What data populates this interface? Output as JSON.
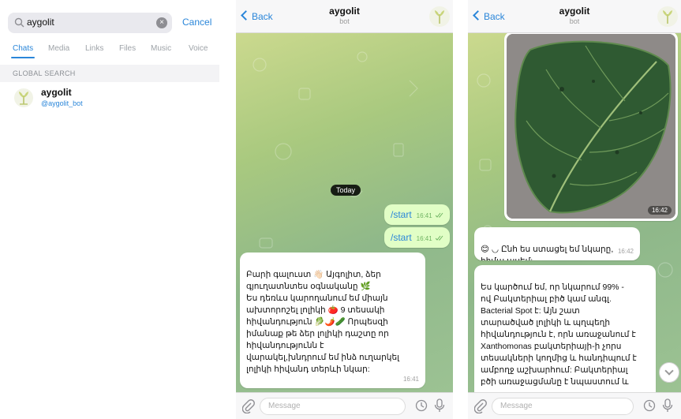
{
  "search_panel": {
    "query": "aygolit",
    "cancel_label": "Cancel",
    "tabs": [
      {
        "label": "Chats",
        "active": true
      },
      {
        "label": "Media",
        "active": false
      },
      {
        "label": "Links",
        "active": false
      },
      {
        "label": "Files",
        "active": false
      },
      {
        "label": "Music",
        "active": false
      },
      {
        "label": "Voice",
        "active": false
      }
    ],
    "section_header": "GLOBAL SEARCH",
    "result": {
      "name": "aygolit",
      "handle": "@aygolit_bot"
    }
  },
  "chat1": {
    "back_label": "Back",
    "title": "aygolit",
    "subtitle": "bot",
    "date_label": "Today",
    "outgoing": [
      {
        "text": "/start",
        "time": "16:41"
      },
      {
        "text": "/start",
        "time": "16:41"
      }
    ],
    "incoming": {
      "text": "Բարի գալուստ 👋🏻 Այգոլիտ, ձեր\nգյուղատնտես օգնականը 🌿\nԵս դեռևս կարողանում եմ միայն\nախտորոշել լոլիկի 🍅 9 տեսակի\nհիվանդություն 🥬🌶️🥒 Որպեսզի\nիմանաք թե ձեր լոլիկի դաշտը որ\nհիվանդությունն է\nվարակել,խնդրում եմ ինձ ուղարկել\nլոլիկի հիվանդ տերևի նկար:",
      "time": "16:41"
    },
    "composer_placeholder": "Message"
  },
  "chat2": {
    "back_label": "Back",
    "title": "aygolit",
    "subtitle": "bot",
    "photo_time": "16:42",
    "reply1": {
      "text": "😊 ◡ Ընհ ես ստացել եմ նկարը,\nհիմա ասեմ:",
      "time": "16:42"
    },
    "reply2": {
      "text": "Ես կարծում եմ, որ նկարում 99% -\nով Բակտերիալ բիծ կամ անգլ.\nBacterial Spot է: Այն շատ\nտարածված լոլիկի և պղպեղի\nհիվանդություն է, որն առաջանում է\nXanthomonas բակտերիայի-ի չորս\nտեսակների կողմից և հանդիպում է\nամբողջ աշխարհում: Բակտերիալ\nբծի առաջացմանը է նպաստում և"
    },
    "composer_placeholder": "Message"
  },
  "colors": {
    "accent": "#2a86d9",
    "outgoing_bubble": "#e1fec6",
    "incoming_bubble": "#ffffff",
    "wallpaper": "#a9c97f"
  },
  "icons": [
    "search-icon",
    "clear-icon",
    "bot-avatar-icon",
    "back-chevron-icon",
    "paperclip-icon",
    "sticker-icon",
    "microphone-icon",
    "double-check-icon",
    "chevron-down-icon"
  ]
}
